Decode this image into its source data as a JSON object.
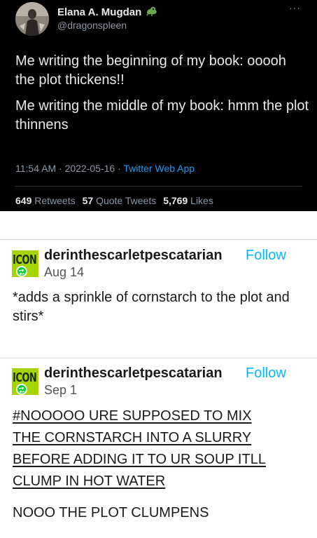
{
  "tweet": {
    "author_name": "Elana A. Mugdan",
    "author_handle": "@dragonspleen",
    "more_label": "···",
    "paragraphs": [
      "Me writing the beginning of my book: ooooh the plot thickens!!",
      "Me writing the middle of my book: hmm the plot thinnens"
    ],
    "time": "11:54 AM",
    "date": "2022-05-16",
    "separator": "·",
    "source": "Twitter Web App",
    "stats": {
      "retweets_count": "649",
      "retweets_label": "Retweets",
      "quotes_count": "57",
      "quotes_label": "Quote Tweets",
      "likes_count": "5,769",
      "likes_label": "Likes"
    },
    "colors": {
      "background": "#000000",
      "link": "#1d9bf0",
      "muted": "#8b98a5"
    }
  },
  "posts": [
    {
      "avatar_text": "ICON",
      "username": "derinthescarletpescatarian",
      "follow_label": "Follow",
      "date": "Aug 14",
      "text": "*adds a sprinkle of cornstarch to the plot and stirs*"
    },
    {
      "avatar_text": "ICON",
      "username": "derinthescarletpescatarian",
      "follow_label": "Follow",
      "date": "Sep 1",
      "underlined_lines": [
        "#NOOOOO URE SUPPOSED TO MIX",
        "THE CORNSTARCH INTO A SLURRY",
        "BEFORE ADDING IT TO UR SOUP ITLL",
        "CLUMP IN HOT WATER"
      ],
      "text": "NOOO THE PLOT CLUMPENS"
    }
  ],
  "icons": {
    "verified_badge": "dragon-badge-icon",
    "reblog": "reblog-icon",
    "more": "more-icon"
  },
  "colors": {
    "follow": "#00b8ff",
    "avatar_bg": "#a6d400",
    "reblog": "#00cf35"
  }
}
